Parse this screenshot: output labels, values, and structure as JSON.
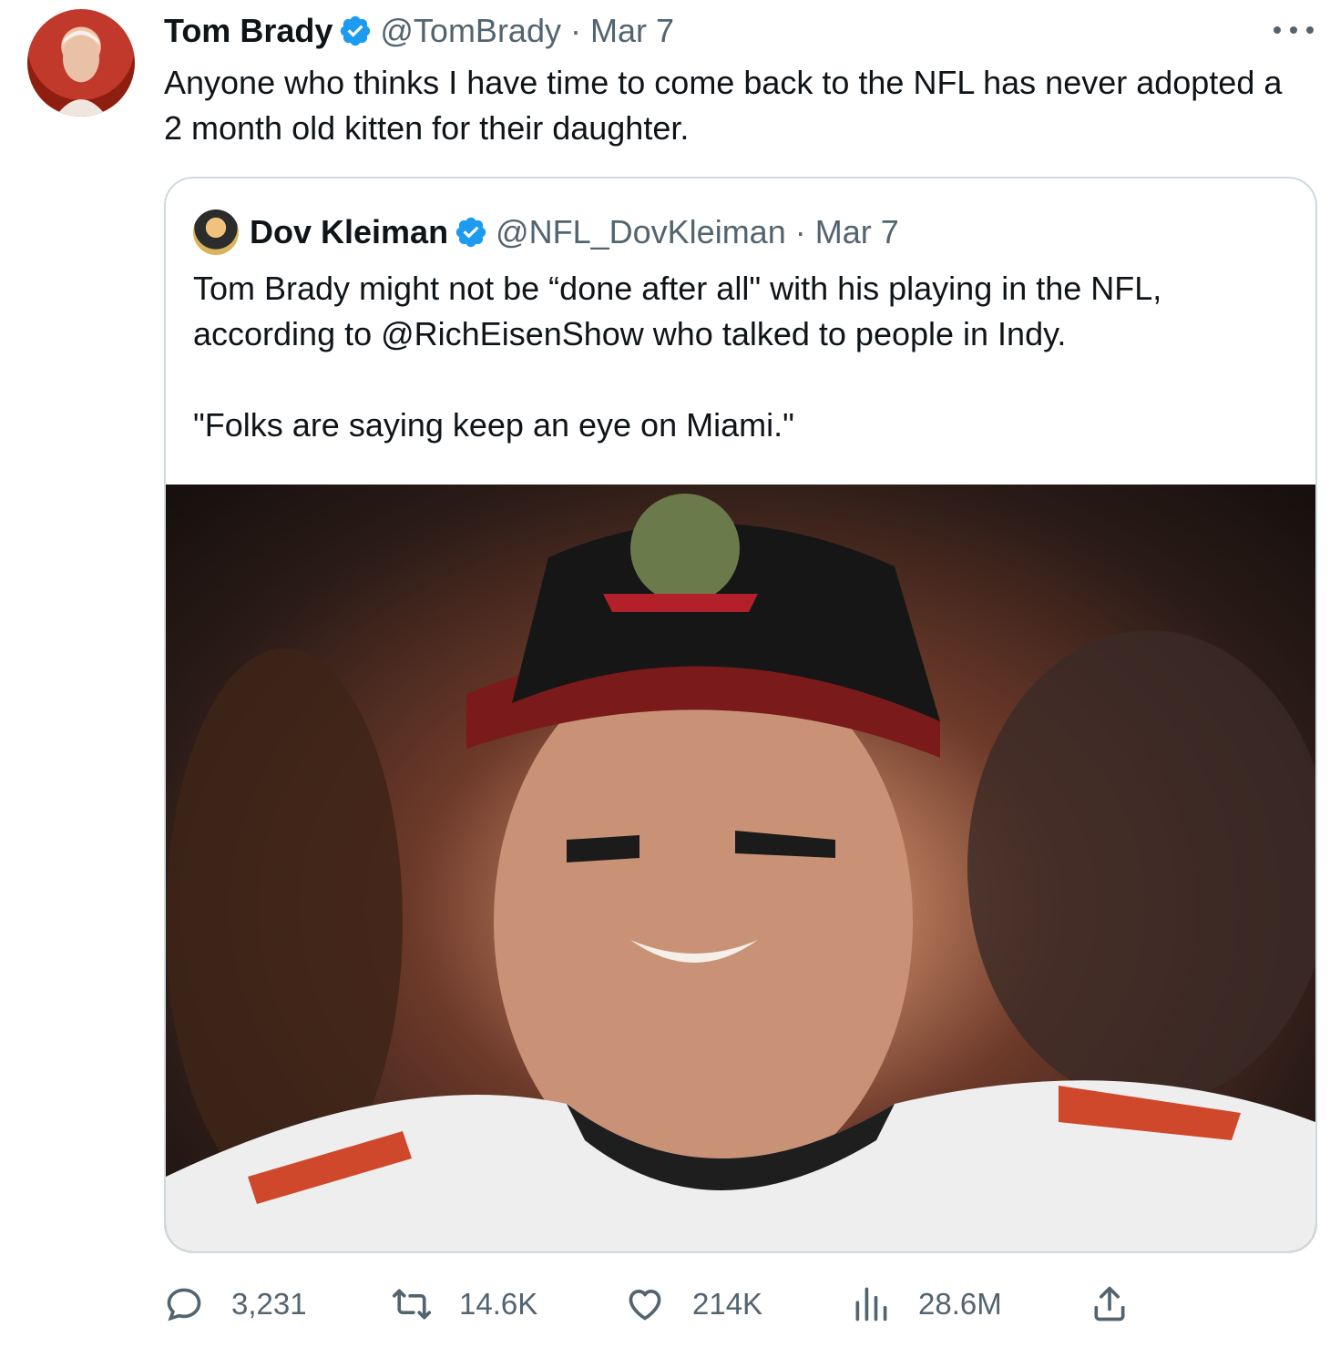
{
  "author": {
    "name": "Tom Brady",
    "handle": "@TomBrady",
    "separator": "·",
    "date": "Mar 7",
    "verified": true
  },
  "tweet_text": "Anyone who thinks I have time to come back to the NFL has never adopted a 2 month old kitten for their daughter.",
  "quoted": {
    "name": "Dov Kleiman",
    "handle": "@NFL_DovKleiman",
    "separator": "·",
    "date": "Mar 7",
    "verified": true,
    "text_line1": "Tom Brady might not be “done after all\" with his playing in the NFL, according to @RichEisenShow who talked to people in Indy.",
    "text_line2": "\"Folks are saying keep an eye on Miami.\"",
    "media": "photo"
  },
  "actions": {
    "replies": "3,231",
    "retweets": "14.6K",
    "likes": "214K",
    "views": "28.6M"
  },
  "icons": {
    "verified": "verified-badge-icon",
    "more": "more-icon",
    "reply": "reply-icon",
    "retweet": "retweet-icon",
    "like": "like-icon",
    "views": "views-icon",
    "share": "share-icon"
  },
  "colors": {
    "accent": "#1d9bf0",
    "text": "#0f1419",
    "secondary": "#536471",
    "border": "#cfd9de"
  }
}
